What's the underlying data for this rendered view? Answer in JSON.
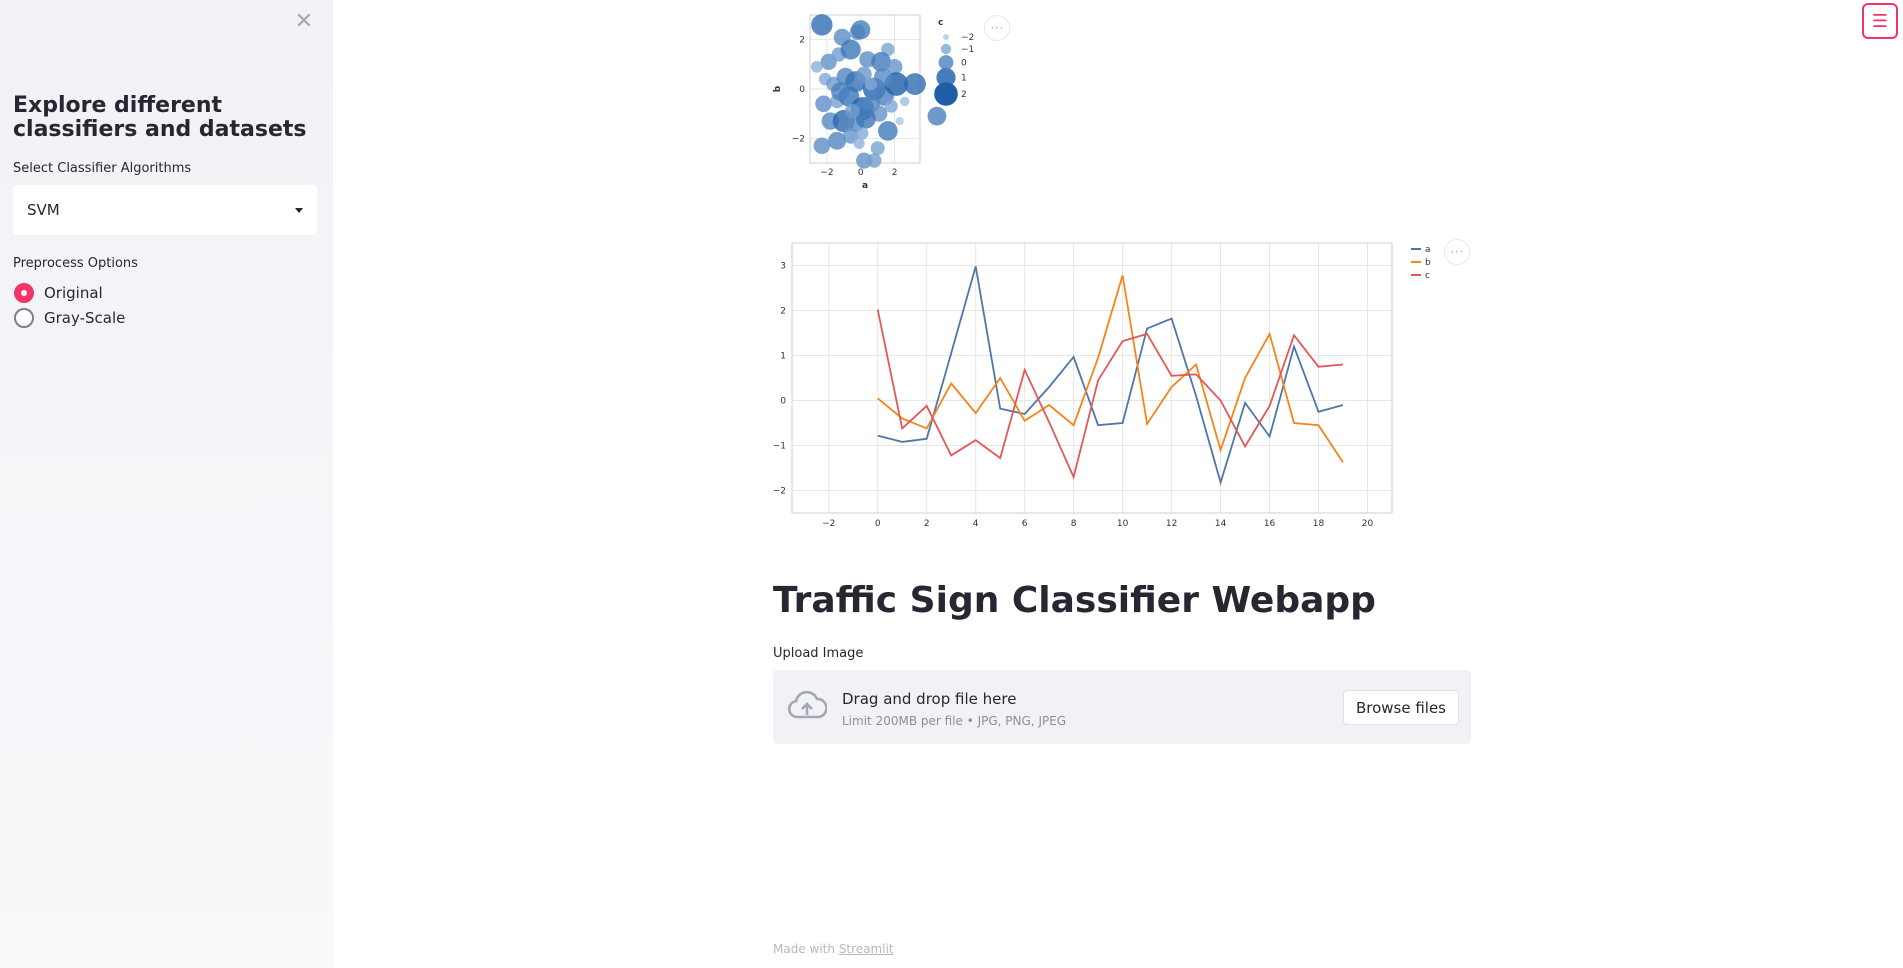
{
  "sidebar": {
    "title": "Explore different classifiers and datasets",
    "classifier_label": "Select Classifier Algorithms",
    "classifier_selected": "SVM",
    "preprocess_label": "Preprocess Options",
    "preprocess_options": [
      {
        "label": "Original",
        "selected": true
      },
      {
        "label": "Gray-Scale",
        "selected": false
      }
    ]
  },
  "main": {
    "title": "Traffic Sign Classifier Webapp",
    "upload": {
      "label": "Upload Image",
      "drop_text": "Drag and drop file here",
      "limit_text": "Limit 200MB per file • JPG, PNG, JPEG",
      "button": "Browse files"
    },
    "footer": {
      "prefix": "Made with",
      "link": "Streamlit"
    }
  },
  "icons": {
    "close": "close-icon",
    "menu": "hamburger-menu-icon",
    "more": "more-dots-icon",
    "upload": "cloud-upload-icon"
  },
  "colors": {
    "accent": "#f63366",
    "series_a": "#4c78a8",
    "series_b": "#f58518",
    "series_c": "#e45756",
    "scatter": "#4c8fcf"
  },
  "chart_data": [
    {
      "type": "scatter",
      "xlabel": "a",
      "ylabel": "b",
      "xlim": [
        -3,
        3.5
      ],
      "ylim": [
        -3,
        3
      ],
      "xticks": [
        "−2",
        "0",
        "2"
      ],
      "yticks": [
        "2",
        "0",
        "−2"
      ],
      "legend": {
        "title": "c",
        "entries": [
          "−2",
          "−1",
          "0",
          "1",
          "2"
        ],
        "placement": "right"
      },
      "points": [
        {
          "x": -2.3,
          "y": 2.6,
          "c": 1.5
        },
        {
          "x": -1.1,
          "y": 2.1,
          "c": 0.5
        },
        {
          "x": -0.2,
          "y": 2.3,
          "c": 0.2
        },
        {
          "x": 0.0,
          "y": 2.4,
          "c": 1.0
        },
        {
          "x": 1.6,
          "y": 1.6,
          "c": -0.3
        },
        {
          "x": -1.9,
          "y": 1.1,
          "c": 0.3
        },
        {
          "x": -1.3,
          "y": 1.4,
          "c": -0.1
        },
        {
          "x": -0.6,
          "y": 1.6,
          "c": 1.2
        },
        {
          "x": 0.4,
          "y": 1.2,
          "c": 0.4
        },
        {
          "x": 1.2,
          "y": 1.1,
          "c": 1.1
        },
        {
          "x": 2.0,
          "y": 0.9,
          "c": 0.2
        },
        {
          "x": -2.1,
          "y": 0.4,
          "c": -0.5
        },
        {
          "x": -1.6,
          "y": 0.2,
          "c": 0.0
        },
        {
          "x": -0.9,
          "y": 0.5,
          "c": 0.7
        },
        {
          "x": -0.3,
          "y": 0.3,
          "c": 1.4
        },
        {
          "x": 0.2,
          "y": 0.6,
          "c": 0.1
        },
        {
          "x": 0.8,
          "y": 0.0,
          "c": 1.8
        },
        {
          "x": 1.4,
          "y": -0.3,
          "c": 0.9
        },
        {
          "x": 2.1,
          "y": 0.2,
          "c": 2.0
        },
        {
          "x": 3.2,
          "y": 0.2,
          "c": 1.6
        },
        {
          "x": -2.2,
          "y": -0.6,
          "c": 0.4
        },
        {
          "x": -1.4,
          "y": -0.5,
          "c": -0.2
        },
        {
          "x": -0.7,
          "y": -0.3,
          "c": 1.3
        },
        {
          "x": 0.1,
          "y": -0.8,
          "c": 1.9
        },
        {
          "x": 0.6,
          "y": -0.6,
          "c": 0.8
        },
        {
          "x": 1.1,
          "y": -1.0,
          "c": 0.3
        },
        {
          "x": 1.8,
          "y": -0.7,
          "c": -0.4
        },
        {
          "x": 2.6,
          "y": -0.5,
          "c": -1.2
        },
        {
          "x": -1.8,
          "y": -1.3,
          "c": 0.6
        },
        {
          "x": -1.0,
          "y": -1.3,
          "c": 1.7
        },
        {
          "x": -0.3,
          "y": -1.4,
          "c": 0.5
        },
        {
          "x": 0.3,
          "y": -1.2,
          "c": 1.2
        },
        {
          "x": 1.6,
          "y": -1.7,
          "c": 1.1
        },
        {
          "x": 4.5,
          "y": -1.1,
          "c": 0.9
        },
        {
          "x": -1.4,
          "y": -2.1,
          "c": 0.7
        },
        {
          "x": -0.6,
          "y": -1.9,
          "c": 0.2
        },
        {
          "x": 0.1,
          "y": -1.8,
          "c": -0.6
        },
        {
          "x": -2.3,
          "y": -2.3,
          "c": 0.4
        },
        {
          "x": -0.1,
          "y": -2.2,
          "c": -0.8
        },
        {
          "x": 1.0,
          "y": -2.4,
          "c": -0.2
        },
        {
          "x": 0.2,
          "y": -2.9,
          "c": 0.3
        },
        {
          "x": 0.8,
          "y": -2.9,
          "c": -0.1
        },
        {
          "x": -2.6,
          "y": 0.9,
          "c": -0.7
        },
        {
          "x": -1.2,
          "y": -0.1,
          "c": 0.9
        },
        {
          "x": 0.6,
          "y": 0.2,
          "c": -0.5
        },
        {
          "x": 1.3,
          "y": 0.5,
          "c": 0.6
        },
        {
          "x": -0.5,
          "y": -0.9,
          "c": 0.0
        },
        {
          "x": 2.3,
          "y": -1.3,
          "c": -1.5
        }
      ]
    },
    {
      "type": "line",
      "xlim": [
        -3.5,
        21
      ],
      "ylim": [
        -2.5,
        3.5
      ],
      "xticks": [
        "−2",
        "0",
        "2",
        "4",
        "6",
        "8",
        "10",
        "12",
        "14",
        "16",
        "18",
        "20"
      ],
      "yticks": [
        "3",
        "2",
        "1",
        "0",
        "−1",
        "−2"
      ],
      "legend": {
        "entries": [
          "a",
          "b",
          "c"
        ],
        "placement": "top-right"
      },
      "x": [
        0,
        1,
        2,
        3,
        4,
        5,
        6,
        7,
        8,
        9,
        10,
        11,
        12,
        13,
        14,
        15,
        16,
        17,
        18,
        19
      ],
      "series": [
        {
          "name": "a",
          "values": [
            -0.78,
            -0.92,
            -0.85,
            1.05,
            2.98,
            -0.18,
            -0.3,
            0.3,
            0.97,
            -0.55,
            -0.5,
            1.6,
            1.82,
            0.1,
            -1.82,
            -0.05,
            -0.8,
            1.2,
            -0.25,
            -0.1
          ]
        },
        {
          "name": "b",
          "values": [
            0.05,
            -0.4,
            -0.62,
            0.38,
            -0.28,
            0.5,
            -0.45,
            -0.1,
            -0.55,
            0.95,
            2.78,
            -0.52,
            0.3,
            0.8,
            -1.1,
            0.5,
            1.48,
            -0.5,
            -0.55,
            -1.37
          ]
        },
        {
          "name": "c",
          "values": [
            2.02,
            -0.62,
            -0.12,
            -1.22,
            -0.88,
            -1.28,
            0.68,
            -0.48,
            -1.7,
            0.45,
            1.32,
            1.48,
            0.55,
            0.58,
            0.0,
            -1.02,
            -0.12,
            1.45,
            0.75,
            0.8
          ]
        }
      ]
    }
  ]
}
